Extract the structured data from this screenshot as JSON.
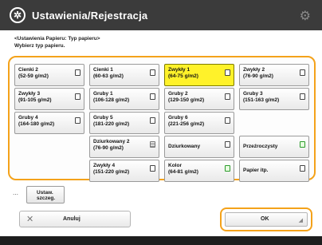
{
  "window": {
    "title": "Ustawienia/Rejestracja"
  },
  "header": {
    "line1": "<Ustawienia Papieru: Typ papieru>",
    "line2": "Wybierz typ papieru."
  },
  "paper_types": [
    {
      "line1": "Cienki 2",
      "line2": "(52-59 g/m2)",
      "icon": "paper-icon",
      "selected": false
    },
    {
      "line1": "Cienki 1",
      "line2": "(60-63 g/m2)",
      "icon": "paper-icon",
      "selected": false
    },
    {
      "line1": "Zwykły 1",
      "line2": "(64-75 g/m2)",
      "icon": "paper-icon",
      "selected": true
    },
    {
      "line1": "Zwykły 2",
      "line2": "(76-90 g/m2)",
      "icon": "paper-icon",
      "selected": false
    },
    {
      "line1": "Zwykły 3",
      "line2": "(91-105 g/m2)",
      "icon": "paper-icon",
      "selected": false
    },
    {
      "line1": "Gruby 1",
      "line2": "(106-128 g/m2)",
      "icon": "paper-icon",
      "selected": false
    },
    {
      "line1": "Gruby 2",
      "line2": "(129-150 g/m2)",
      "icon": "paper-icon",
      "selected": false
    },
    {
      "line1": "Gruby 3",
      "line2": "(151-163 g/m2)",
      "icon": "paper-icon",
      "selected": false
    },
    {
      "line1": "Gruby 4",
      "line2": "(164-180 g/m2)",
      "icon": "paper-icon",
      "selected": false
    },
    {
      "line1": "Gruby 5",
      "line2": "(181-220 g/m2)",
      "icon": "paper-icon",
      "selected": false
    },
    {
      "line1": "Gruby 6",
      "line2": "(221-256 g/m2)",
      "icon": "paper-icon",
      "selected": false
    },
    {
      "line1": "Dziurkowany 2",
      "line2": "(76-90 g/m2)",
      "icon": "punched-icon",
      "selected": false
    },
    {
      "line1": "Dziurkowany",
      "line2": "",
      "icon": "paper-icon",
      "selected": false
    },
    {
      "line1": "Przeźroczysty",
      "line2": "",
      "icon": "transparency-icon",
      "selected": false
    },
    {
      "line1": "Zwykły 4",
      "line2": "(151-220 g/m2)",
      "icon": "paper-icon",
      "selected": false
    },
    {
      "line1": "Kolor",
      "line2": "(64-81 g/m2)",
      "icon": "color-icon",
      "selected": false
    },
    {
      "line1": "Papier itp.",
      "line2": "",
      "icon": "paper-icon",
      "selected": false
    }
  ],
  "store_button": {
    "line1": "Ustaw.",
    "line2": "szczeg."
  },
  "footer": {
    "cancel_label": "Anuluj",
    "ok_label": "OK"
  },
  "colors": {
    "accent": "#f4a21a",
    "selected": "#fff22a",
    "titlebar": "#3b3b3b"
  }
}
